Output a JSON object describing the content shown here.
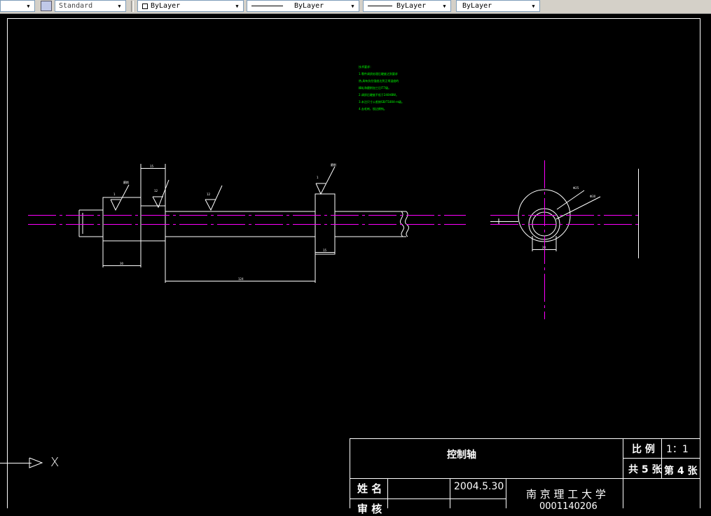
{
  "toolbar": {
    "textstyle": "Standard",
    "layer": "ByLayer",
    "linetype": "ByLayer",
    "lineweight": "ByLayer",
    "plotstyle": "ByLayer"
  },
  "drawing": {
    "notes": [
      "技术要求：",
      "1.零件调质处理后硬度达到要求",
      "热,具有抗拉强度达到正常温度的",
      "精轧和磨削加工后IT7级。",
      "2.调质后硬度不低于240HBW。",
      "3.未注尺寸公差按GB/T1804-m级。",
      "4.去毛刺，锐边倒钝。"
    ],
    "dims": {
      "d1": "15",
      "d2": "30",
      "d3": "124",
      "d4": "15",
      "d5": "Φ25",
      "d6": "Φ30",
      "d7": "20",
      "rough1": "1",
      "rough2": "12",
      "rough3": "12",
      "rough4": "1",
      "note1": "磨削",
      "note2": "磨削"
    },
    "ucs_label": "X"
  },
  "title_block": {
    "part_name": "控制轴",
    "scale_label": "比 例",
    "scale_value": "1：1",
    "sheet_total": "共 5 张",
    "sheet_no": "第 4 张",
    "name_label": "姓 名",
    "date": "2004.5.30",
    "school": "南 京 理 工 大 学",
    "student_id": "0001140206",
    "review_label": "审 核"
  },
  "colors": {
    "background": "#000000",
    "lines": "#ffffff",
    "centerline": "#ff00ff",
    "notes": "#00ff00"
  }
}
